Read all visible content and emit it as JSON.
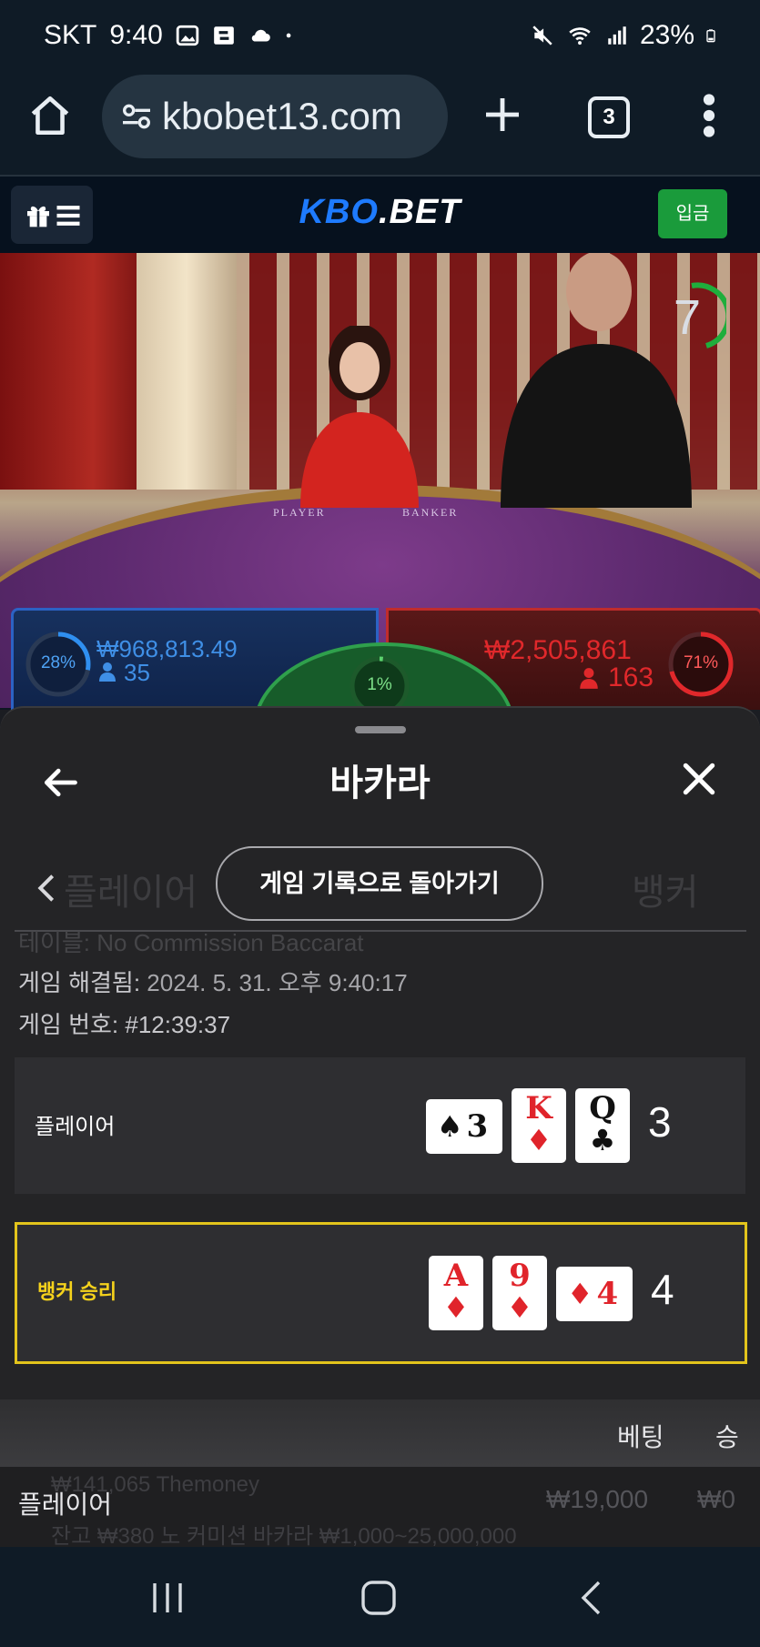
{
  "status_bar": {
    "carrier": "SKT",
    "time": "9:40",
    "battery": "23%",
    "icons": [
      "gallery-icon",
      "sync-icon",
      "cloud-icon",
      "dot-icon",
      "mute-icon",
      "wifi-icon",
      "signal-icon",
      "battery-icon"
    ]
  },
  "browser": {
    "url": "kbobet13.com",
    "tab_count": "3"
  },
  "site": {
    "logo_main": "KBO",
    "logo_suffix": ".BET",
    "deposit_label": "입금"
  },
  "video": {
    "player_table_label": "PLAYER",
    "banker_table_label": "BANKER",
    "timer": "7"
  },
  "bets": {
    "player": {
      "percent": "28%",
      "amount": "₩968,813.49",
      "count": "35",
      "percent_value": 28
    },
    "banker": {
      "percent": "71%",
      "amount": "₩2,505,861",
      "count": "163",
      "percent_value": 71
    },
    "tie": {
      "percent": "1%",
      "percent_value": 1
    }
  },
  "sheet": {
    "title": "바카라",
    "ghost_tab_left": "플레이어",
    "ghost_tab_right": "뱅커",
    "return_button": "게임 기록으로 돌아가기",
    "ghost_line": "테이블: No Commission Baccarat",
    "resolved_label": "게임 해결됨:",
    "resolved_value": "2024. 5. 31. 오후 9:40:17",
    "game_no_label": "게임 번호:",
    "game_no_value": "#12:39:37"
  },
  "results": {
    "player": {
      "label": "플레이어",
      "score": "3",
      "cards": [
        {
          "rank": "3",
          "suit": "♠",
          "color": "black",
          "sideways": true
        },
        {
          "rank": "K",
          "suit": "♦",
          "color": "red",
          "sideways": false
        },
        {
          "rank": "Q",
          "suit": "♣",
          "color": "black",
          "sideways": false
        }
      ]
    },
    "banker": {
      "label": "뱅커 승리",
      "score": "4",
      "cards": [
        {
          "rank": "A",
          "suit": "♦",
          "color": "red",
          "sideways": false
        },
        {
          "rank": "9",
          "suit": "♦",
          "color": "red",
          "sideways": false
        },
        {
          "rank": "4",
          "suit": "♦",
          "color": "red",
          "sideways": true
        }
      ]
    }
  },
  "betting": {
    "col_bet": "베팅",
    "col_win": "승",
    "row_label": "플레이어",
    "row_bet": "₩19,000",
    "row_win": "₩0",
    "ghost_user": "₩141,065 Themoney",
    "ghost_limits": "잔고 ₩380      노 커미션 바카라 ₩1,000~25,000,000"
  },
  "colors": {
    "accent_blue": "#1e7bff",
    "deposit_green": "#1a9b3b",
    "winner_border": "#e3c41c",
    "player_blue": "#2c62c4",
    "banker_red": "#c02c2c"
  }
}
